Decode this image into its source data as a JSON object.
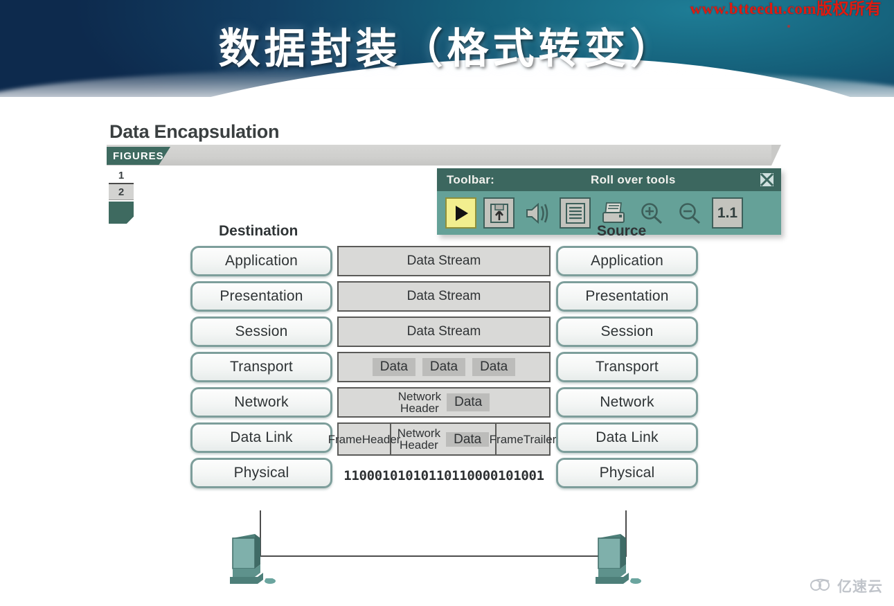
{
  "slide": {
    "title": "数据封装（格式转变）",
    "watermark_top": "www.btteedu.com版权所有",
    "watermark_bottom": "亿速云"
  },
  "figure": {
    "title": "Data Encapsulation",
    "tab_label": "FIGURES",
    "page_tabs": [
      "1",
      "2"
    ]
  },
  "toolbar": {
    "label": "Toolbar:",
    "hint": "Roll over tools",
    "close_icon": "close-icon",
    "scale_label": "1.1",
    "buttons": [
      {
        "name": "play-icon",
        "label": "Play"
      },
      {
        "name": "save-icon",
        "label": "Save"
      },
      {
        "name": "speaker-icon",
        "label": "Audio"
      },
      {
        "name": "text-icon",
        "label": "Text"
      },
      {
        "name": "print-icon",
        "label": "Print"
      },
      {
        "name": "zoom-in-icon",
        "label": "Zoom In"
      },
      {
        "name": "zoom-out-icon",
        "label": "Zoom Out"
      }
    ]
  },
  "diagram": {
    "left_header": "Destination",
    "right_header": "Source",
    "layers": [
      "Application",
      "Presentation",
      "Session",
      "Transport",
      "Network",
      "Data Link",
      "Physical"
    ],
    "pdus": {
      "application": "Data Stream",
      "presentation": "Data Stream",
      "session": "Data Stream",
      "transport_segments": [
        "Data",
        "Data",
        "Data"
      ],
      "network_header_l1": "Network",
      "network_header_l2": "Header",
      "network_data": "Data",
      "frame_header_l1": "Frame",
      "frame_header_l2": "Header",
      "frame_network_l1": "Network",
      "frame_network_l2": "Header",
      "frame_data": "Data",
      "frame_trailer_l1": "Frame",
      "frame_trailer_l2": "Trailer",
      "physical_bits": "11000101010110110000101001"
    },
    "devices": [
      "destination-pc",
      "source-pc"
    ]
  },
  "colors": {
    "banner_dark": "#0b2344",
    "banner_teal": "#15687f",
    "toolbar_title": "#3c675f",
    "toolbar_body": "#65a198",
    "tab_green": "#3e6a60",
    "box_border": "#7d9e9b",
    "pdu_fill": "#d9d9d7",
    "watermark_red": "#e01a10"
  }
}
